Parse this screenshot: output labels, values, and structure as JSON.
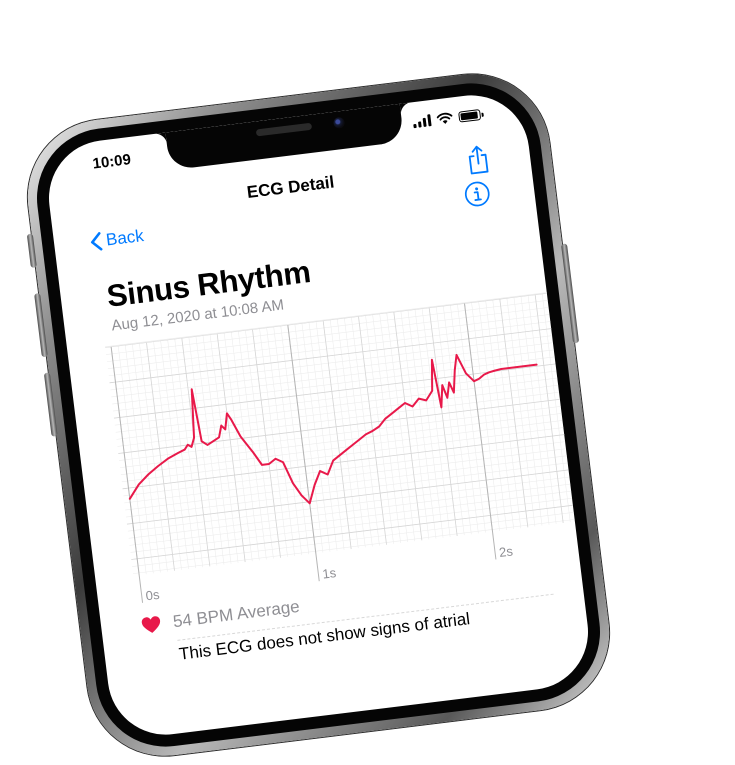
{
  "status_bar": {
    "time": "10:09"
  },
  "nav": {
    "title": "ECG Detail",
    "back_label": "Back"
  },
  "result": {
    "classification": "Sinus Rhythm",
    "recorded": "Aug 12, 2020 at 10:08 AM",
    "average": "54 BPM Average",
    "description_visible": "This ECG does not show signs of atrial"
  },
  "colors": {
    "accent": "#007aff",
    "ecg_trace": "#e8194a",
    "heart": "#e8194a",
    "secondary_text": "#8e8e93"
  },
  "chart_data": {
    "type": "line",
    "x_ticks": [
      "0s",
      "1s",
      "2s"
    ],
    "grid": true,
    "series": [
      {
        "x": [
          0.0,
          0.06,
          0.12,
          0.18,
          0.24,
          0.3,
          0.34,
          0.36,
          0.38,
          0.4,
          0.42,
          0.44,
          0.47,
          0.5,
          0.54,
          0.56,
          0.58,
          0.6,
          0.62,
          0.64,
          0.66,
          0.69,
          0.72,
          0.76,
          0.8,
          0.84,
          0.88,
          0.92,
          0.96,
          1.0,
          1.04,
          1.08,
          1.12,
          1.16,
          1.2,
          1.24,
          1.28,
          1.32,
          1.36,
          1.4,
          1.44,
          1.48,
          1.52,
          1.56,
          1.6,
          1.64,
          1.68,
          1.72,
          1.76,
          1.78,
          1.8,
          1.82,
          1.84,
          1.86,
          1.88,
          1.9,
          1.92,
          1.96,
          2.0,
          2.03,
          2.06,
          2.09,
          2.12,
          2.16,
          2.2,
          2.24,
          2.28,
          2.32,
          2.36
        ],
        "y": [
          -0.15,
          0.0,
          0.1,
          0.18,
          0.25,
          0.3,
          0.33,
          0.38,
          0.35,
          0.45,
          1.0,
          0.4,
          0.35,
          0.38,
          0.42,
          0.55,
          0.5,
          0.68,
          0.6,
          0.5,
          0.4,
          0.3,
          0.2,
          0.05,
          0.05,
          0.1,
          0.05,
          -0.2,
          -0.35,
          -0.45,
          -0.25,
          -0.1,
          -0.15,
          0.0,
          0.05,
          0.1,
          0.15,
          0.2,
          0.25,
          0.28,
          0.32,
          0.4,
          0.45,
          0.5,
          0.55,
          0.5,
          0.58,
          0.55,
          0.65,
          1.0,
          0.45,
          0.7,
          0.55,
          0.72,
          0.6,
          0.85,
          1.02,
          0.8,
          0.7,
          0.72,
          0.76,
          0.78,
          0.79,
          0.8,
          0.8,
          0.8,
          0.8,
          0.8,
          0.8
        ]
      }
    ]
  }
}
